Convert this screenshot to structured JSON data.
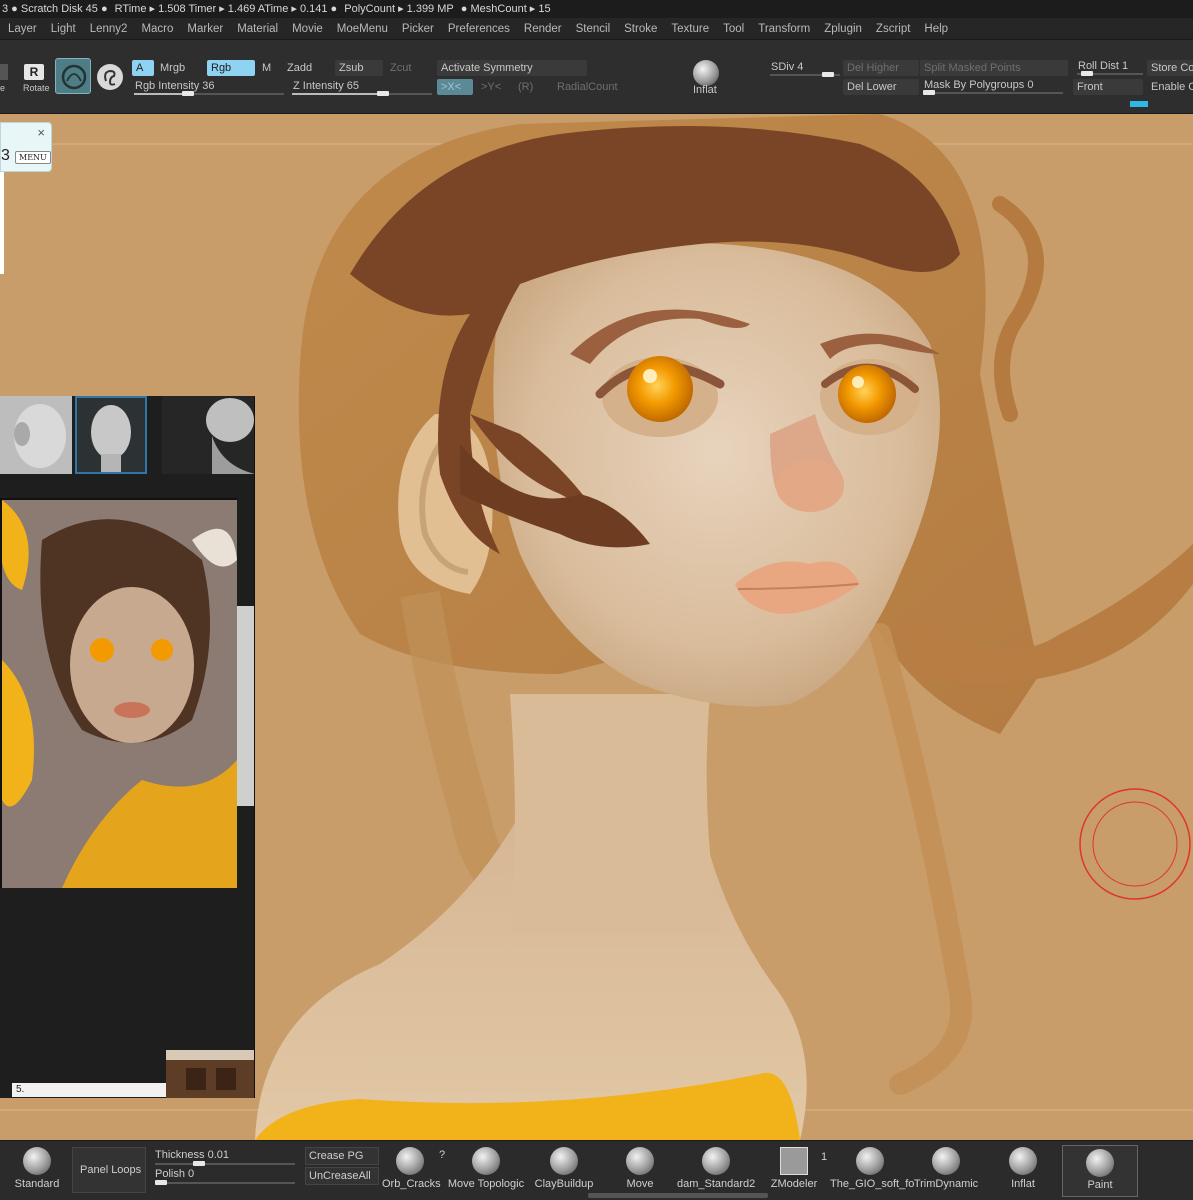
{
  "statusbar": {
    "items": [
      "3 ● Scratch Disk 45 ●",
      "RTime ▸ 1.508 Timer ▸ 1.469 ATime ▸ 0.141 ●",
      "PolyCount ▸ 1.399 MP",
      "● MeshCount ▸ 15"
    ]
  },
  "menubar": {
    "items": [
      "Layer",
      "Light",
      "Lenny2",
      "Macro",
      "Marker",
      "Material",
      "Movie",
      "MoeMenu",
      "Picker",
      "Preferences",
      "Render",
      "Stencil",
      "Stroke",
      "Texture",
      "Tool",
      "Transform",
      "Zplugin",
      "Zscript",
      "Help"
    ]
  },
  "toolbar": {
    "scale_label": "e",
    "rotate_label": "Rotate",
    "a_label": "A",
    "mrgb_label": "Mrgb",
    "rgb_label": "Rgb",
    "m_label": "M",
    "zadd_label": "Zadd",
    "zsub_label": "Zsub",
    "zcut_label": "Zcut",
    "rgb_intensity_label": "Rgb Intensity 36",
    "rgb_intensity_value": 36,
    "z_intensity_label": "Z Intensity 65",
    "z_intensity_value": 65,
    "activate_symmetry_label": "Activate Symmetry",
    "x_sym_label": ">X<",
    "y_sym_label": ">Y<",
    "r_sym_label": "(R)",
    "radial_count_label": "RadialCount",
    "inflat_label": "Inflat",
    "sdiv_label": "SDiv 4",
    "del_higher_label": "Del Higher",
    "del_lower_label": "Del Lower",
    "split_masked_label": "Split Masked Points",
    "mask_by_polygroups_label": "Mask By Polygroups 0",
    "roll_dist_label": "Roll Dist 1",
    "front_label": "Front",
    "store_label": "Store Co",
    "enable_label": "Enable C"
  },
  "float_note": {
    "big_text": "3",
    "menu_label": "MENU",
    "close_label": "×"
  },
  "ref_panel": {
    "caption": "5."
  },
  "bottombar": {
    "standard_label": "Standard",
    "panel_loops_label": "Panel Loops",
    "thickness_label": "Thickness 0.01",
    "polish_label": "Polish 0",
    "crease_pg_label": "Crease PG",
    "uncrease_all_label": "UnCreaseAll",
    "orb_cracks_label": "Orb_Cracks",
    "question_label": "?",
    "move_topologic_label": "Move Topologic",
    "claybuildup_label": "ClayBuildup",
    "move_label": "Move",
    "dam_standard2_label": "dam_Standard2",
    "zmodeler_label": "ZModeler",
    "one_label": "1",
    "gio_label": "The_GIO_soft_fo",
    "trimdynamic_label": "TrimDynamic",
    "inflat_label": "Inflat",
    "paint_label": "Paint"
  },
  "colors": {
    "canvas_bg": "#c89d6a",
    "accent_active": "#8fd3f2",
    "brush_cursor": "#e0342a",
    "eye_orange": "#f39a00"
  }
}
